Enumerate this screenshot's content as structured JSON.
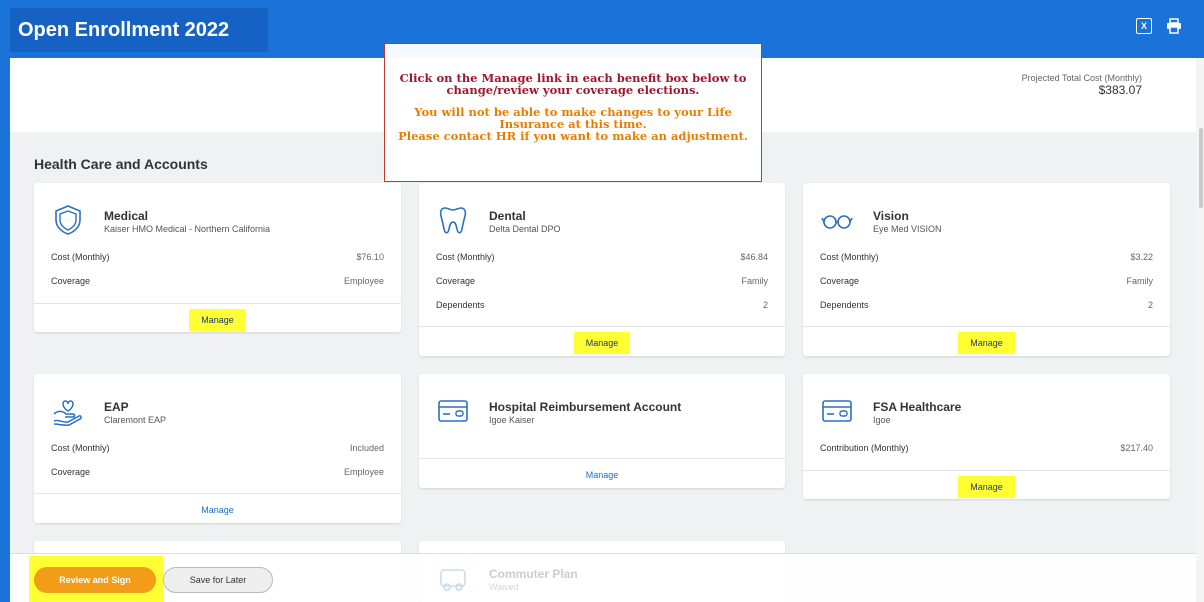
{
  "header": {
    "title": "Open Enrollment 2022",
    "excel_icon": "excel-icon",
    "print_icon": "print-icon"
  },
  "projected": {
    "label": "Projected Total Cost (Monthly)",
    "value": "$383.07"
  },
  "notice": {
    "line1": "Click on the Manage link in each  benefit box below to",
    "line2": "change/review your coverage elections.",
    "line3": "You will not be able to make changes to your Life",
    "line4": "Insurance at this time.",
    "line5": "Please contact HR if you want to make an adjustment."
  },
  "section": {
    "title": "Health Care and Accounts"
  },
  "cards": {
    "medical": {
      "name": "Medical",
      "plan": "Kaiser HMO Medical - Northern California",
      "cost_label": "Cost (Monthly)",
      "cost": "$76.10",
      "coverage_label": "Coverage",
      "coverage": "Employee",
      "manage": "Manage",
      "icon": "shield-icon"
    },
    "dental": {
      "name": "Dental",
      "plan": "Delta Dental DPO",
      "cost_label": "Cost (Monthly)",
      "cost": "$46.84",
      "coverage_label": "Coverage",
      "coverage": "Family",
      "dependents_label": "Dependents",
      "dependents": "2",
      "manage": "Manage",
      "icon": "tooth-icon"
    },
    "vision": {
      "name": "Vision",
      "plan": "Eye Med VISION",
      "cost_label": "Cost (Monthly)",
      "cost": "$3.22",
      "coverage_label": "Coverage",
      "coverage": "Family",
      "dependents_label": "Dependents",
      "dependents": "2",
      "manage": "Manage",
      "icon": "glasses-icon"
    },
    "eap": {
      "name": "EAP",
      "plan": "Claremont EAP",
      "cost_label": "Cost (Monthly)",
      "cost": "Included",
      "coverage_label": "Coverage",
      "coverage": "Employee",
      "manage": "Manage",
      "icon": "hands-heart-icon"
    },
    "hra": {
      "name": "Hospital Reimbursement Account",
      "plan": "Igoe Kaiser",
      "manage": "Manage",
      "icon": "card-icon"
    },
    "fsa": {
      "name": "FSA Healthcare",
      "plan": "Igoe",
      "contribution_label": "Contribution (Monthly)",
      "contribution": "$217.40",
      "manage": "Manage",
      "icon": "card-icon"
    },
    "commuter": {
      "name": "Commuter Plan",
      "plan": "Waived",
      "icon": "car-icon"
    }
  },
  "footer": {
    "review_label": "Review and Sign",
    "save_label": "Save for Later"
  },
  "colors": {
    "brand": "#1a73d9",
    "highlight": "#ffff33",
    "review_button": "#f39c1a"
  }
}
